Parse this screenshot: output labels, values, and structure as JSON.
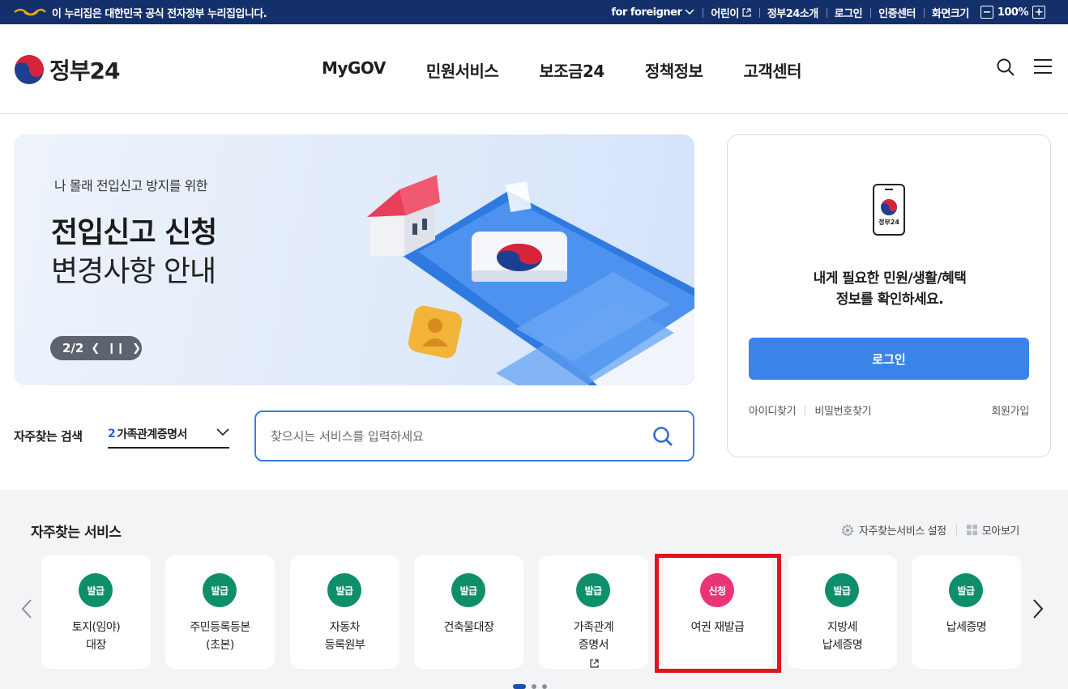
{
  "top_banner": {
    "notice": "이 누리집은 대한민국 공식 전자정부 누리집입니다.",
    "links": [
      "for foreigner",
      "어린이",
      "정부24소개",
      "로그인",
      "인증센터"
    ],
    "zoom_label": "화면크기",
    "zoom_value": "100%",
    "colors": {
      "background": "#14306b",
      "mark": "#e6a817"
    }
  },
  "header": {
    "logo_text": "정부24",
    "nav": [
      "MyGOV",
      "민원서비스",
      "보조금24",
      "정책정보",
      "고객센터"
    ],
    "icons": [
      "search-icon",
      "menu-icon"
    ]
  },
  "hero": {
    "eyebrow": "나 몰래 전입신고 방지를 위한",
    "title_line1": "전입신고 신청",
    "title_line2": "변경사항 안내",
    "pager_text": "2/2",
    "pager_controls": [
      "chevron-left-icon",
      "pause-icon",
      "chevron-right-icon"
    ]
  },
  "login_box": {
    "phone_label": "정부24",
    "message_line1": "내게 필요한 민원/생활/혜택",
    "message_line2": "정보를 확인하세요.",
    "login_button": "로그인",
    "find_id": "아이디찾기",
    "find_password": "비밀번호찾기",
    "join": "회원가입",
    "accent_color": "#3a84e8"
  },
  "frequent_search": {
    "label": "자주찾는 검색",
    "rank": "2",
    "term": "가족관계증명서"
  },
  "search": {
    "placeholder": "찾으시는 서비스를 입력하세요"
  },
  "frequent_services": {
    "title": "자주찾는 서비스",
    "settings_label": "자주찾는서비스 설정",
    "view_all_label": "모아보기",
    "cards": [
      {
        "badge": "발급",
        "line1": "토지(임야)",
        "line2": "대장"
      },
      {
        "badge": "발급",
        "line1": "주민등록등본",
        "line2": "(초본)"
      },
      {
        "badge": "발급",
        "line1": "자동차",
        "line2": "등록원부"
      },
      {
        "badge": "발급",
        "line1": "건축물대장",
        "line2": ""
      },
      {
        "badge": "발급",
        "line1": "가족관계",
        "line2": "증명서"
      },
      {
        "badge": "신청",
        "line1": "여권 재발급",
        "line2": ""
      },
      {
        "badge": "발급",
        "line1": "지방세",
        "line2": "납세증명"
      },
      {
        "badge": "발급",
        "line1": "납세증명",
        "line2": ""
      }
    ],
    "badge_colors": {
      "발급": "#0f8e6b",
      "신청": "#eb3477"
    },
    "highlight_color": "#e0141e",
    "page_dots": 3,
    "active_dot": 1
  }
}
